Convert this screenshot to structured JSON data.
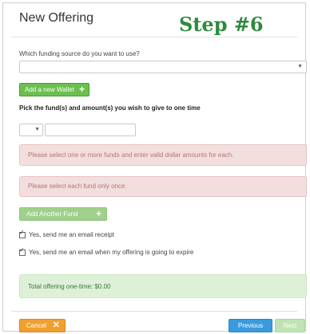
{
  "dialog": {
    "title": "New Offering",
    "step_label": "Step #6"
  },
  "funding": {
    "question": "Which funding source do you want to use?",
    "select_value": "",
    "add_wallet_label": "Add a new Wallet"
  },
  "funds": {
    "question": "Pick the fund(s) and amount(s) you wish to give to one time",
    "amount_value": ""
  },
  "alerts": [
    "Please select one or more funds and enter valid dollar amounts for each.",
    "Please select each fund only once."
  ],
  "add_another_fund_label": "Add Another Fund",
  "options": {
    "email_receipt": "Yes, send me an email receipt",
    "email_expire": "Yes, send me an email when my offering is going to expire"
  },
  "total": "Total offering one-time: $0.00",
  "footer": {
    "cancel_label": "Cancel",
    "previous_label": "Previous",
    "next_label": "Next"
  },
  "colors": {
    "step_label": "#2e8b3d",
    "primary_green": "#6cbf4f",
    "alert_bg": "#f3dede",
    "success_bg": "#dff0d8",
    "cancel": "#f0a030",
    "previous": "#3a9bdc"
  }
}
